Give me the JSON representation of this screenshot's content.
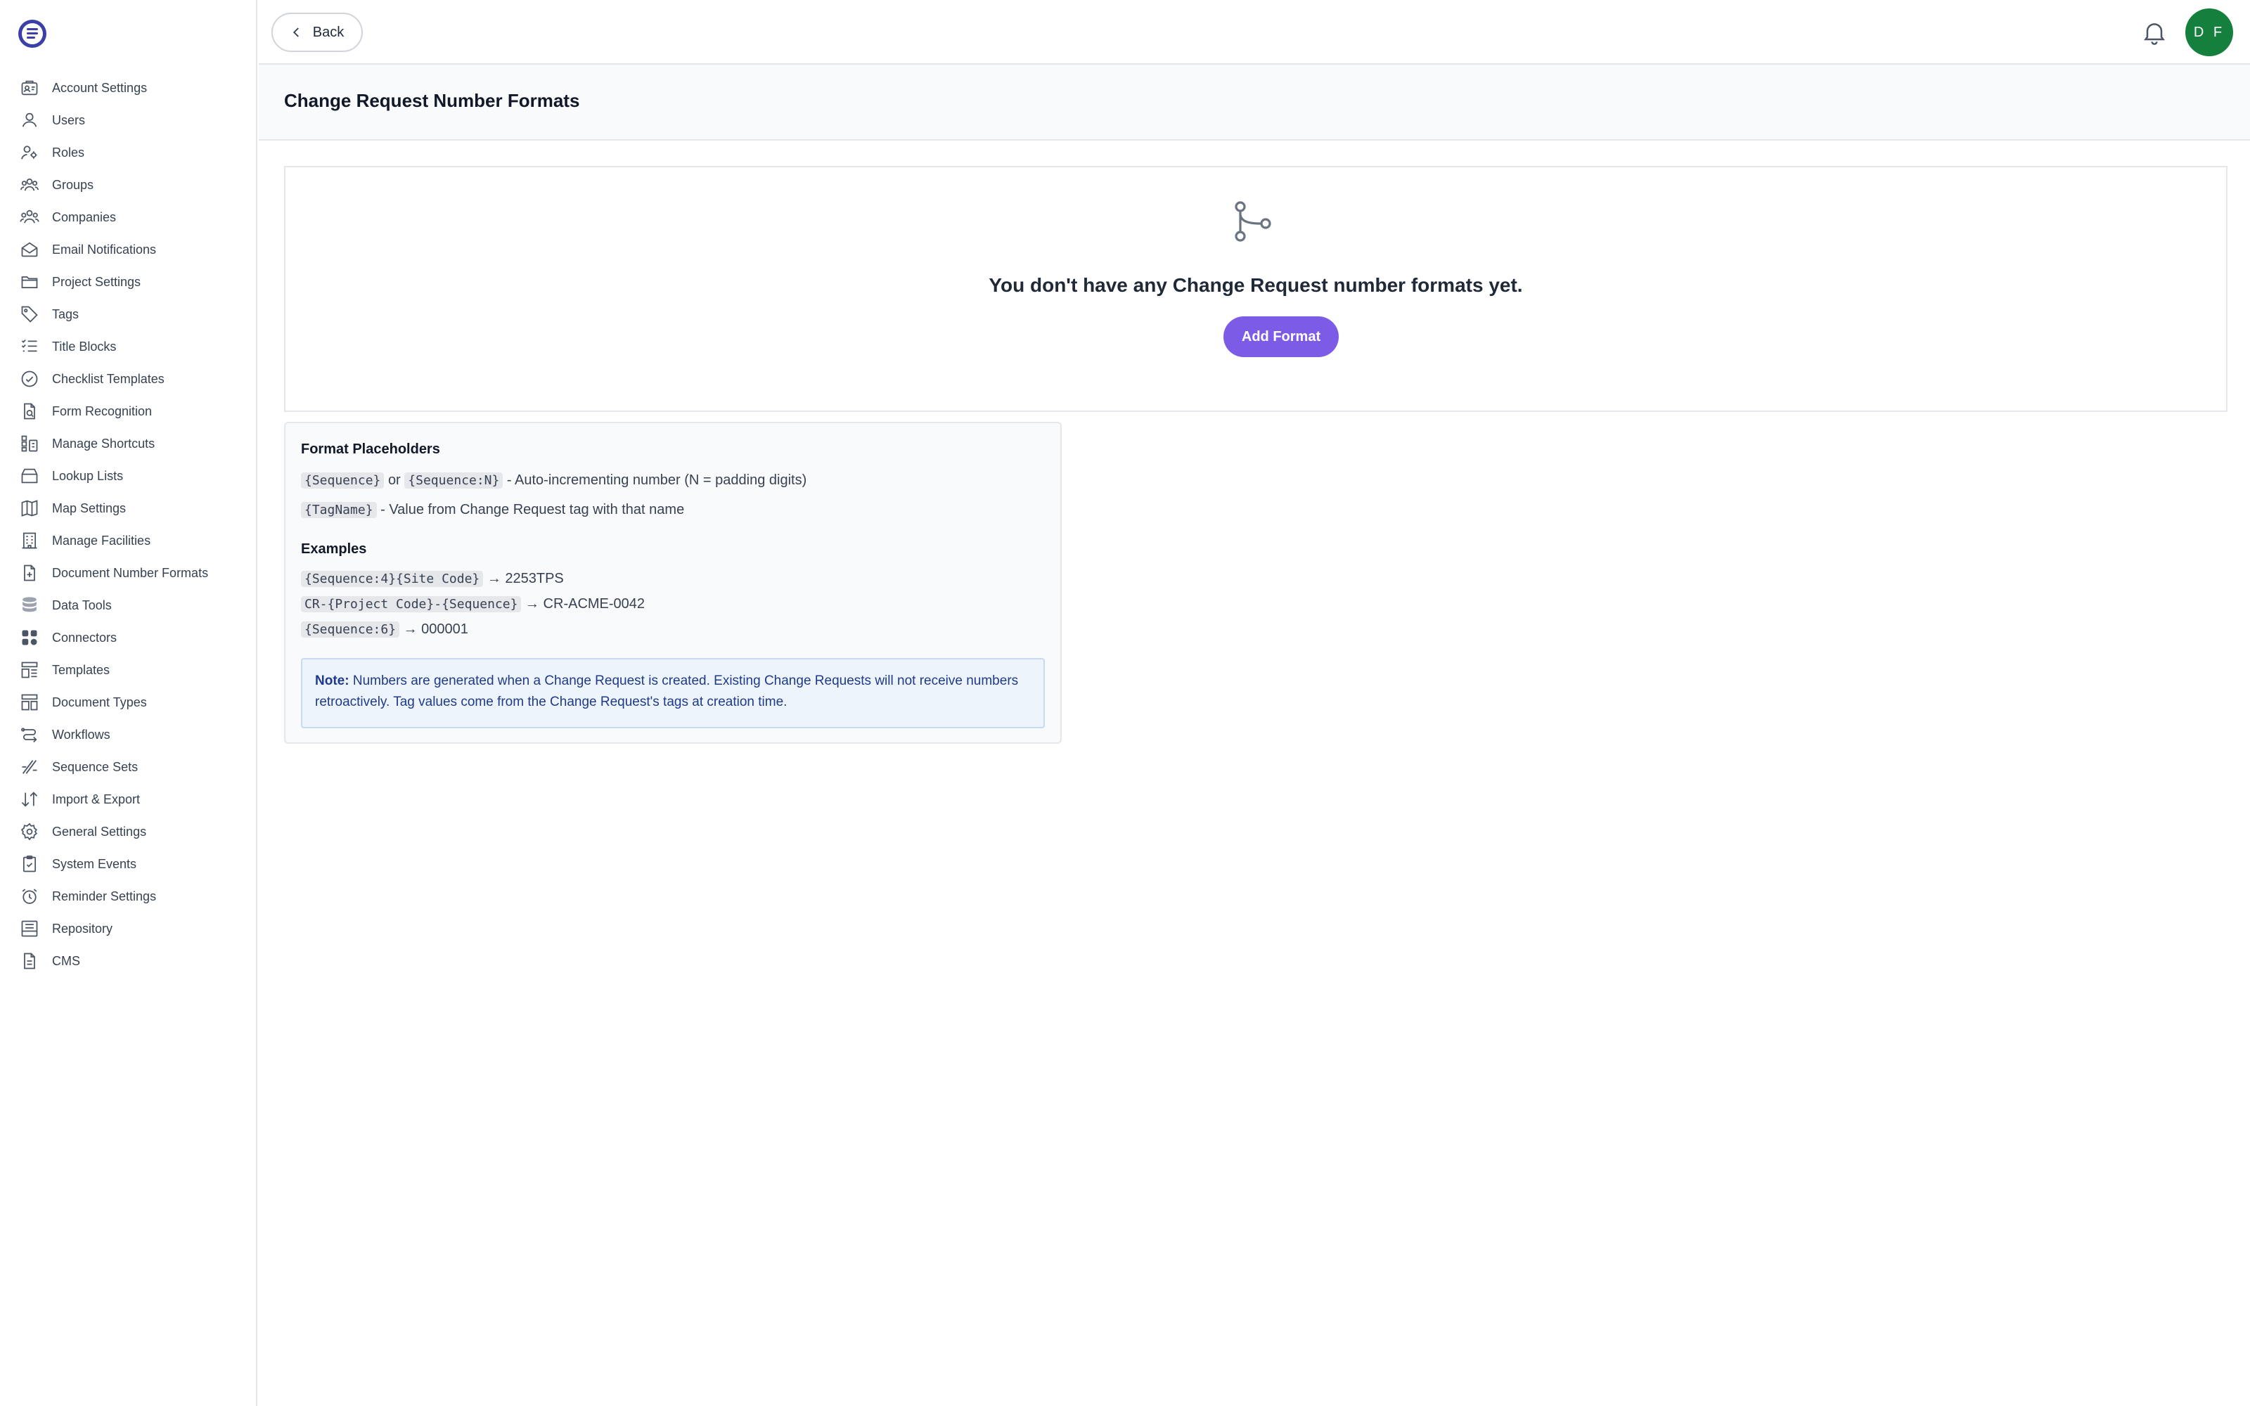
{
  "sidebar": {
    "items": [
      {
        "label": "Account Settings",
        "icon": "account-settings-icon"
      },
      {
        "label": "Users",
        "icon": "user-icon"
      },
      {
        "label": "Roles",
        "icon": "roles-icon"
      },
      {
        "label": "Groups",
        "icon": "groups-icon"
      },
      {
        "label": "Companies",
        "icon": "companies-icon"
      },
      {
        "label": "Email Notifications",
        "icon": "mail-icon"
      },
      {
        "label": "Project Settings",
        "icon": "folder-icon"
      },
      {
        "label": "Tags",
        "icon": "tag-icon"
      },
      {
        "label": "Title Blocks",
        "icon": "list-icon"
      },
      {
        "label": "Checklist Templates",
        "icon": "check-circle-icon"
      },
      {
        "label": "Form Recognition",
        "icon": "form-recognition-icon"
      },
      {
        "label": "Manage Shortcuts",
        "icon": "shortcuts-icon"
      },
      {
        "label": "Lookup Lists",
        "icon": "lookup-icon"
      },
      {
        "label": "Map Settings",
        "icon": "map-icon"
      },
      {
        "label": "Manage Facilities",
        "icon": "building-icon"
      },
      {
        "label": "Document Number Formats",
        "icon": "document-number-icon"
      },
      {
        "label": "Data Tools",
        "icon": "database-icon"
      },
      {
        "label": "Connectors",
        "icon": "connectors-icon"
      },
      {
        "label": "Templates",
        "icon": "templates-icon"
      },
      {
        "label": "Document Types",
        "icon": "document-types-icon"
      },
      {
        "label": "Workflows",
        "icon": "workflow-icon"
      },
      {
        "label": "Sequence Sets",
        "icon": "sequence-icon"
      },
      {
        "label": "Import & Export",
        "icon": "import-export-icon"
      },
      {
        "label": "General Settings",
        "icon": "gear-icon"
      },
      {
        "label": "System Events",
        "icon": "clipboard-check-icon"
      },
      {
        "label": "Reminder Settings",
        "icon": "alarm-icon"
      },
      {
        "label": "Repository",
        "icon": "repository-icon"
      },
      {
        "label": "CMS",
        "icon": "file-icon"
      }
    ]
  },
  "topbar": {
    "back_label": "Back",
    "avatar_initials": "D F"
  },
  "page": {
    "title": "Change Request Number Formats"
  },
  "empty_state": {
    "message": "You don't have any Change Request number formats yet.",
    "add_label": "Add Format"
  },
  "help": {
    "placeholders_heading": "Format Placeholders",
    "seq_code": "{Sequence}",
    "or_text": "or",
    "seqn_code": "{Sequence:N}",
    "seq_desc": "- Auto-incrementing number (N = padding digits)",
    "tag_code": "{TagName}",
    "tag_desc": "- Value from Change Request tag with that name",
    "examples_heading": "Examples",
    "examples": [
      {
        "code": "{Sequence:4}{Site Code}",
        "result": "→ 2253TPS"
      },
      {
        "code": "CR-{Project Code}-{Sequence}",
        "result": "→ CR-ACME-0042"
      },
      {
        "code": "{Sequence:6}",
        "result": "→ 000001"
      }
    ],
    "note_label": "Note:",
    "note_text": "Numbers are generated when a Change Request is created. Existing Change Requests will not receive numbers retroactively. Tag values come from the Change Request's tags at creation time."
  },
  "colors": {
    "accent": "#7c5ce6",
    "avatar": "#15803d",
    "note_bg": "#eef4fc",
    "note_text": "#1e3a8a"
  }
}
